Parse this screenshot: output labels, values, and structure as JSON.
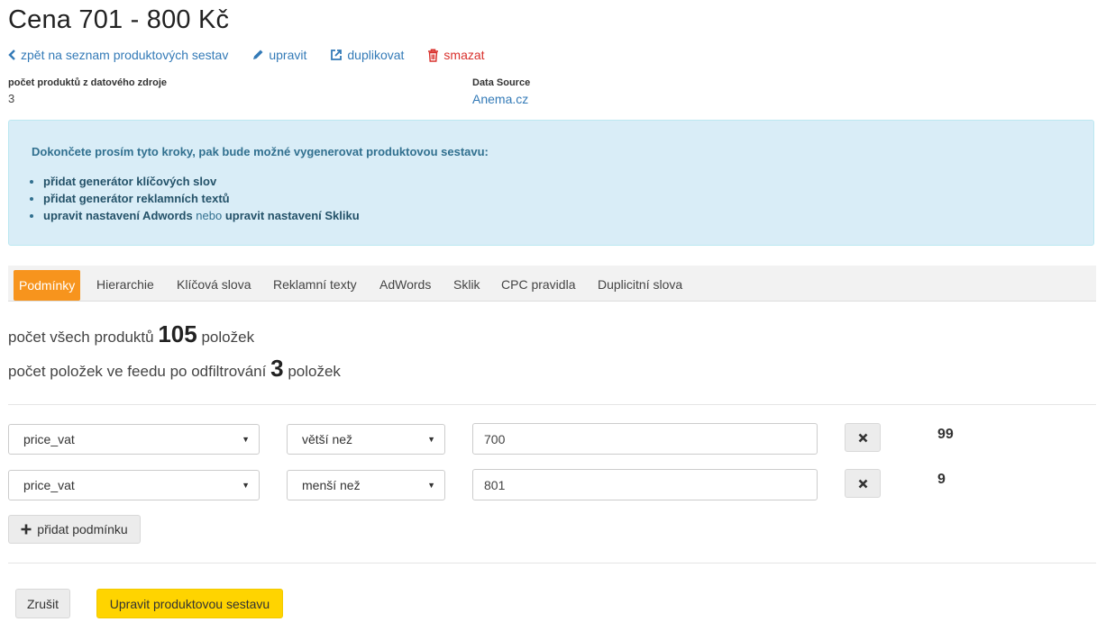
{
  "header": {
    "title": "Cena 701 - 800 Kč"
  },
  "actions": {
    "back": "zpět na seznam produktových sestav",
    "edit": "upravit",
    "duplicate": "duplikovat",
    "delete": "smazat"
  },
  "meta": {
    "products_label": "počet produktů z datového zdroje",
    "products_value": "3",
    "source_label": "Data Source",
    "source_value": "Anema.cz"
  },
  "alert": {
    "heading": "Dokončete prosím tyto kroky, pak bude možné vygenerovat produktovou sestavu:",
    "item1": "přidat generátor klíčových slov",
    "item2": "přidat generátor reklamních textů",
    "item3_a": "upravit nastavení Adwords",
    "item3_or": "nebo",
    "item3_b": "upravit nastavení Skliku"
  },
  "tabs": [
    "Podmínky",
    "Hierarchie",
    "Klíčová slova",
    "Reklamní texty",
    "AdWords",
    "Sklik",
    "CPC pravidla",
    "Duplicitní slova"
  ],
  "stats": {
    "all_prefix": "počet všech produktů",
    "all_count": "105",
    "all_suffix": "položek",
    "filtered_prefix": "počet položek ve feedu po odfiltrování",
    "filtered_count": "3",
    "filtered_suffix": "položek"
  },
  "conditions": [
    {
      "field": "price_vat",
      "operator": "větší než",
      "value": "700",
      "count": "99"
    },
    {
      "field": "price_vat",
      "operator": "menší než",
      "value": "801",
      "count": "9"
    }
  ],
  "add_condition": "přidat podmínku",
  "footer": {
    "cancel": "Zrušit",
    "submit": "Upravit produktovou sestavu"
  },
  "colors": {
    "accent": "#f7941d",
    "link": "#337ab7",
    "danger": "#d9302c",
    "info_bg": "#d9edf7",
    "primary_button": "#ffd400"
  }
}
